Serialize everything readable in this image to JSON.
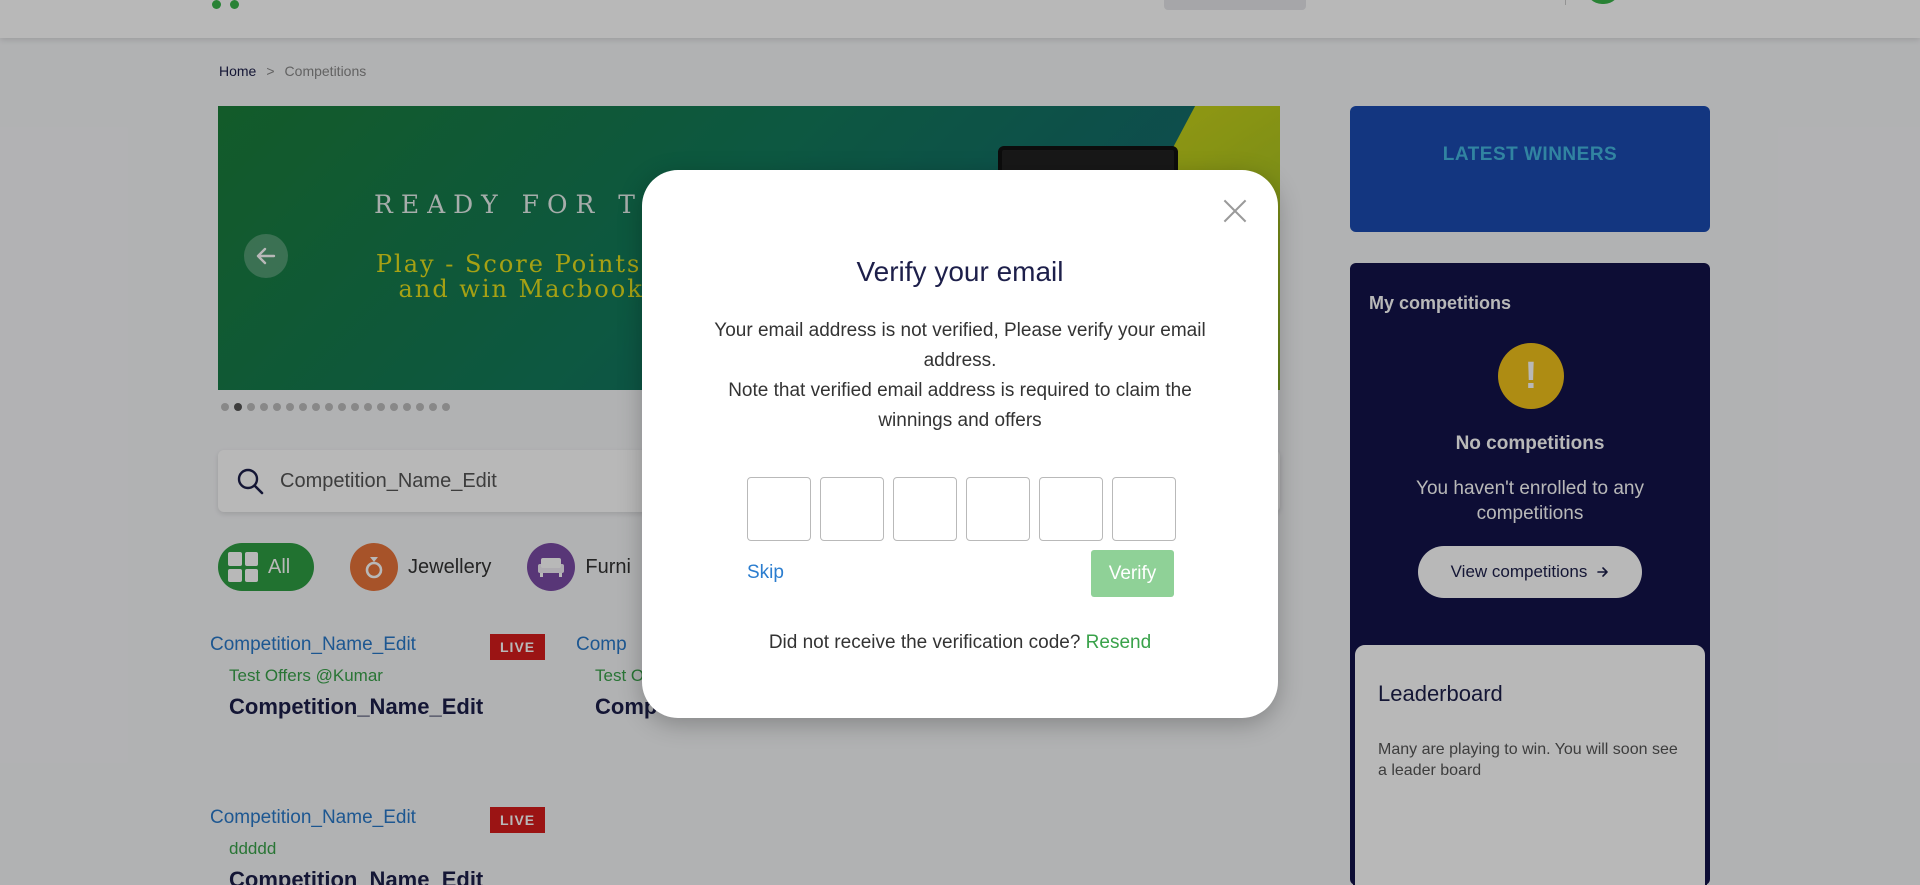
{
  "breadcrumb": {
    "home": "Home",
    "separator": ">",
    "current": "Competitions"
  },
  "banner": {
    "line1": "READY FOR THE",
    "line2": "Play - Score Points - Win",
    "line3": "and win Macbook Pro",
    "prev_icon": "arrow-left-icon",
    "slide_count": 18,
    "active_slide": 2
  },
  "search": {
    "value": "Competition_Name_Edit",
    "icon": "search-icon"
  },
  "categories": [
    {
      "label": "All",
      "icon": "grid-icon",
      "active": true
    },
    {
      "label": "Jewellery",
      "icon": "ring-icon"
    },
    {
      "label": "Furni",
      "icon": "sofa-icon"
    }
  ],
  "cards": [
    {
      "image_alt": "Competition_Name_Edit",
      "badge": "LIVE",
      "subtitle": "Test Offers @Kumar",
      "title": "Competition_Name_Edit"
    },
    {
      "image_alt": "Comp",
      "badge": "",
      "subtitle": "Test O",
      "title": "Competition_Name_Edit"
    },
    {
      "image_alt": "Competition_Name_Edit",
      "badge": "LIVE",
      "subtitle": "ddddd",
      "title": "Competition_Name_Edit"
    }
  ],
  "latest_winners": {
    "label": "LATEST WINNERS"
  },
  "my_competitions": {
    "heading": "My competitions",
    "empty_title": "No competitions",
    "empty_message": "You haven't enrolled to any competitions",
    "button_label": "View competitions"
  },
  "leaderboard": {
    "heading": "Leaderboard",
    "message": "Many are playing to win. You will soon see a leader board"
  },
  "modal": {
    "title": "Verify your email",
    "description_1": "Your email address is not verified, Please verify your email address.",
    "description_2": "Note that verified email address is required to claim the winnings and offers",
    "otp_length": 6,
    "skip_label": "Skip",
    "verify_label": "Verify",
    "resend_prompt": "Did not receive the verification code?",
    "resend_label": "Resend"
  },
  "colors": {
    "brand_green": "#39a24a",
    "navy": "#12124a",
    "winners_blue": "#1b4cb2",
    "live_red": "#d71c1c",
    "verify_disabled": "#8fd197",
    "link_blue": "#2b7dcf"
  }
}
